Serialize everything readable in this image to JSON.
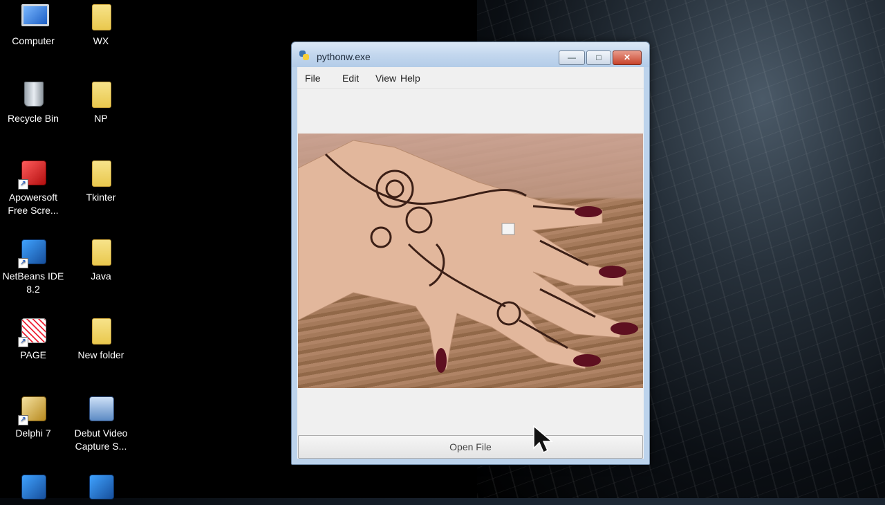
{
  "desktop": {
    "icons": [
      {
        "label": "Computer",
        "icon": "computer-icon"
      },
      {
        "label": "WX",
        "icon": "folder-icon"
      },
      {
        "label": "Recycle Bin",
        "icon": "recycle-bin-icon"
      },
      {
        "label": "NP",
        "icon": "folder-icon"
      },
      {
        "label": "Apowersoft Free Scre...",
        "icon": "apowersoft-icon"
      },
      {
        "label": "Tkinter",
        "icon": "folder-icon"
      },
      {
        "label": "NetBeans IDE 8.2",
        "icon": "netbeans-icon"
      },
      {
        "label": "Java",
        "icon": "folder-icon"
      },
      {
        "label": "PAGE",
        "icon": "page-app-icon"
      },
      {
        "label": "New folder",
        "icon": "folder-icon"
      },
      {
        "label": "Delphi 7",
        "icon": "delphi-icon"
      },
      {
        "label": "Debut Video Capture S...",
        "icon": "debut-video-icon"
      }
    ]
  },
  "window": {
    "title": "pythonw.exe",
    "controls": {
      "minimize": "—",
      "maximize": "□",
      "close": "✕"
    },
    "menu": [
      "File",
      "Edit",
      "View",
      "Help"
    ],
    "image": {
      "description_icon": "henna-hand-photo"
    },
    "open_button_label": "Open File"
  }
}
